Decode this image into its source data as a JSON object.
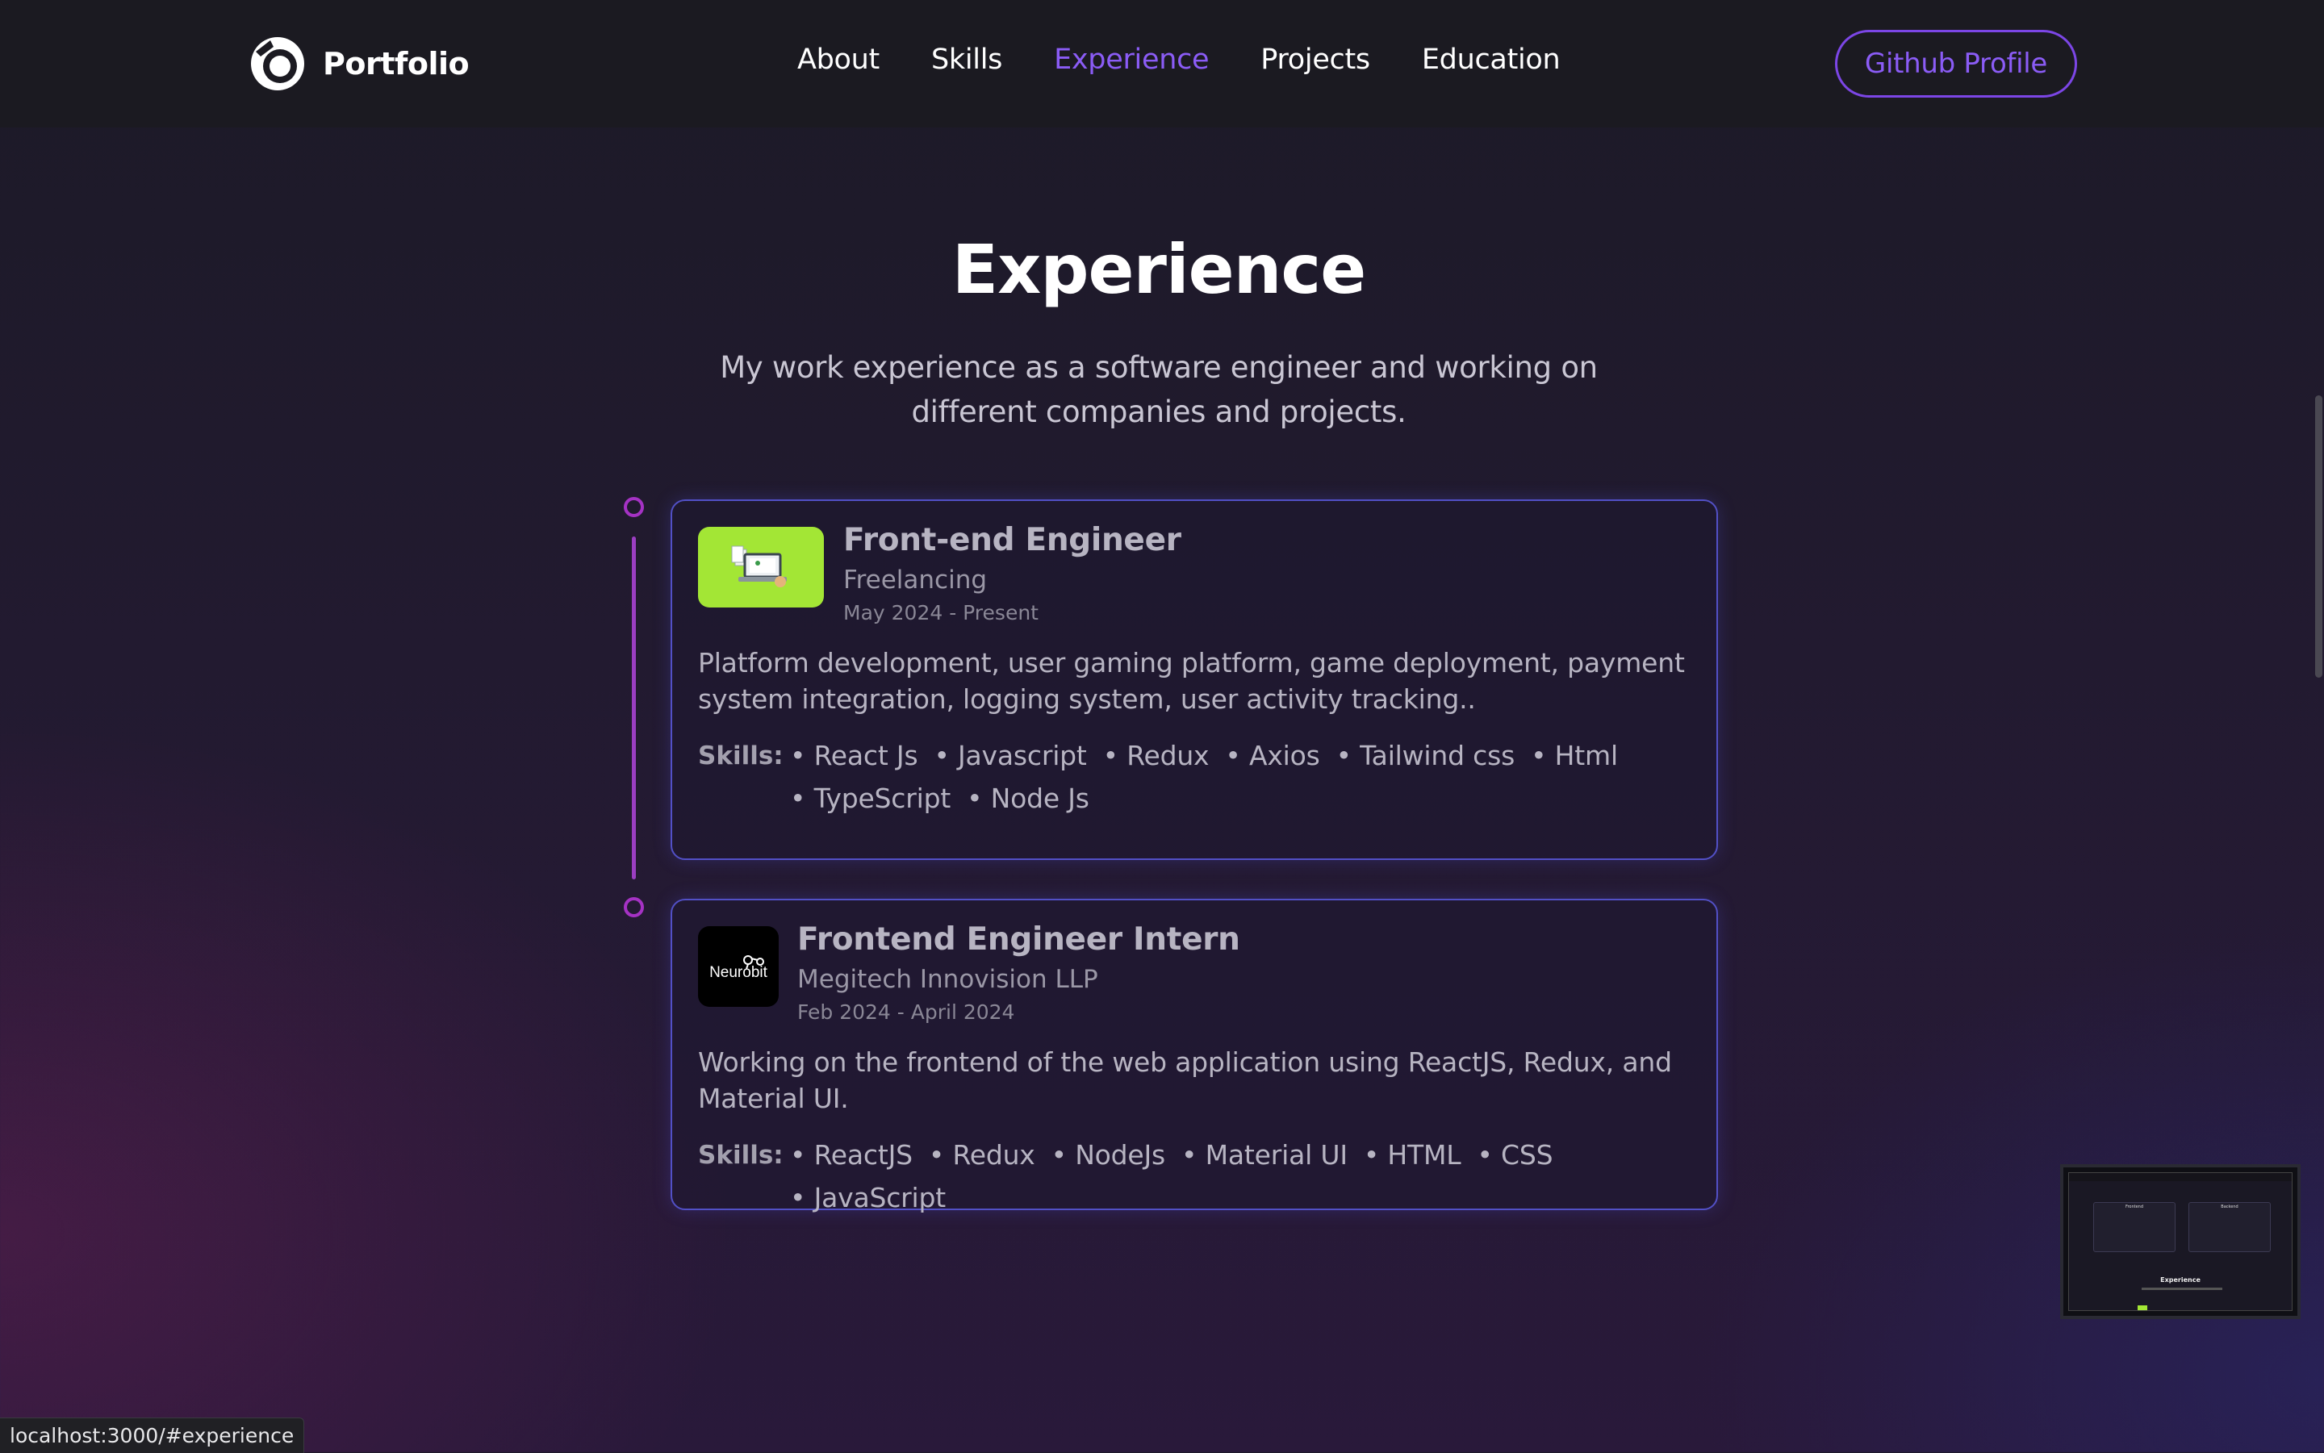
{
  "nav": {
    "logo_text": "Portfolio",
    "links": [
      "About",
      "Skills",
      "Experience",
      "Projects",
      "Education"
    ],
    "active": "Experience",
    "github_button": "Github Profile"
  },
  "section": {
    "title": "Experience",
    "subtitle": "My work experience as a software engineer and working on different companies and projects."
  },
  "experiences": [
    {
      "role": "Front-end Engineer",
      "company": "Freelancing",
      "date": "May 2024 - Present",
      "description": "Platform development, user gaming platform, game deployment, payment system integration, logging system, user activity tracking..",
      "skills_label": "Skills:",
      "skills": [
        "React Js",
        "Javascript",
        "Redux",
        "Axios",
        "Tailwind css",
        "Html",
        "TypeScript",
        "Node Js"
      ]
    },
    {
      "role": "Frontend Engineer Intern",
      "company": "Megitech Innovision LLP",
      "date": "Feb 2024 - April 2024",
      "description": "Working on the frontend of the web application using ReactJS, Redux, and Material UI.",
      "skills_label": "Skills:",
      "skills": [
        "ReactJS",
        "Redux",
        "NodeJs",
        "Material UI",
        "HTML",
        "CSS",
        "JavaScript"
      ],
      "logo_text": "Neurobit"
    }
  ],
  "preview": {
    "heading": "Experience",
    "col_left": "Frontend",
    "col_right": "Backend"
  },
  "status_url": "localhost:3000/#experience",
  "colors": {
    "accent": "#8b5cf6",
    "timeline": "#a532c4",
    "card_border": "#5250c6",
    "freelance_logo_bg": "#a3e635"
  }
}
